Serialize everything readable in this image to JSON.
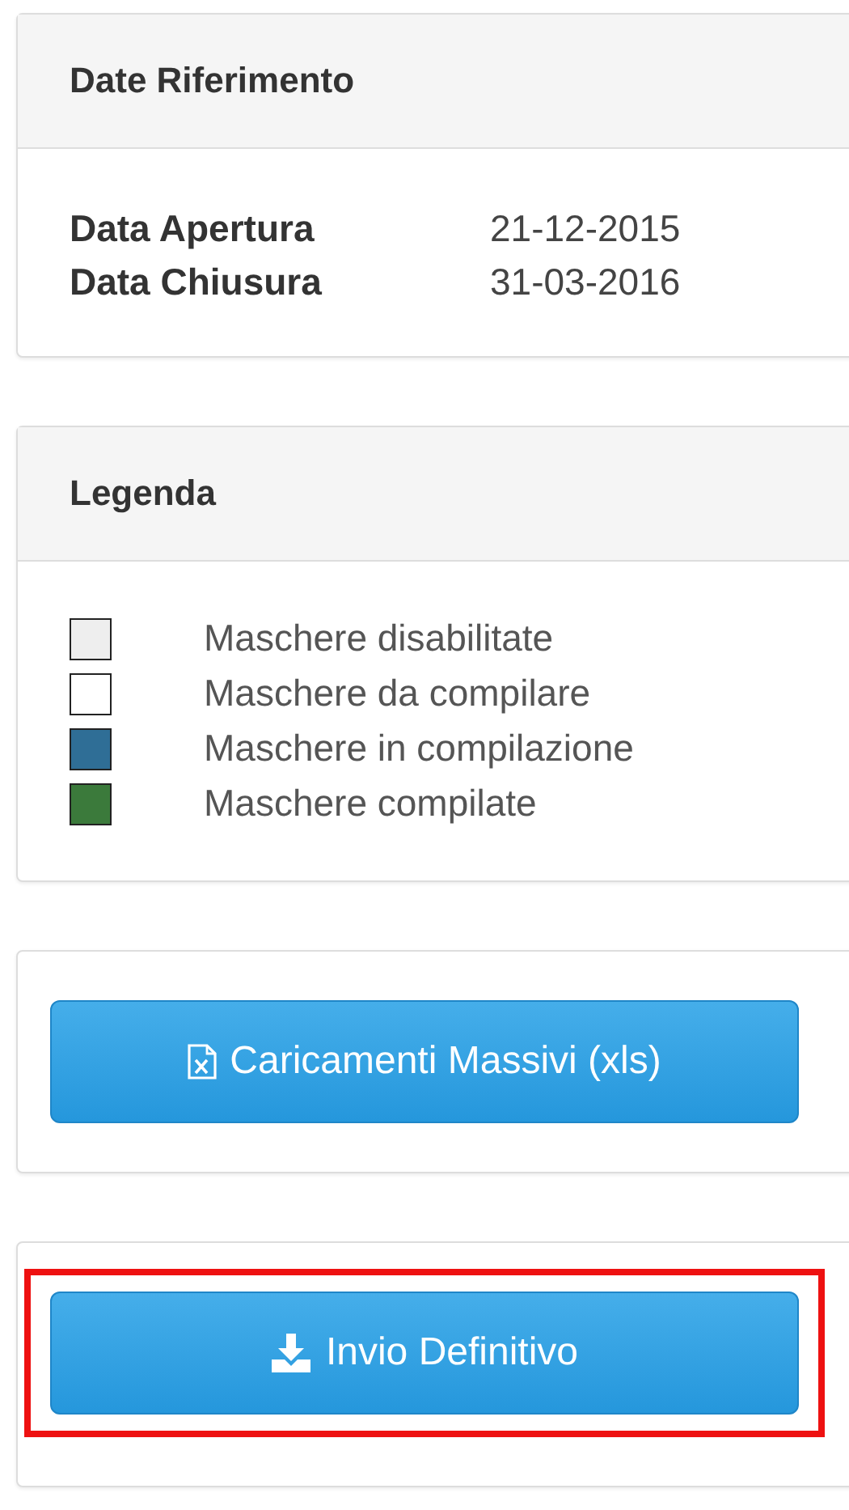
{
  "date_panel": {
    "title": "Date Riferimento",
    "fields": [
      {
        "label": "Data Apertura",
        "value": "21-12-2015"
      },
      {
        "label": "Data Chiusura",
        "value": "31-03-2016"
      }
    ]
  },
  "legend_panel": {
    "title": "Legenda",
    "items": [
      {
        "label": "Maschere disabilitate",
        "color": "#eeeeee"
      },
      {
        "label": "Maschere da compilare",
        "color": "#ffffff"
      },
      {
        "label": "Maschere in compilazione",
        "color": "#2f6e96"
      },
      {
        "label": "Maschere compilate",
        "color": "#3b7a3b"
      }
    ]
  },
  "action_panels": [
    {
      "label": "Caricamenti Massivi (xls)",
      "kind": "excel",
      "highlighted": false
    },
    {
      "label": "Invio Definitivo",
      "kind": "download",
      "highlighted": true
    }
  ]
}
